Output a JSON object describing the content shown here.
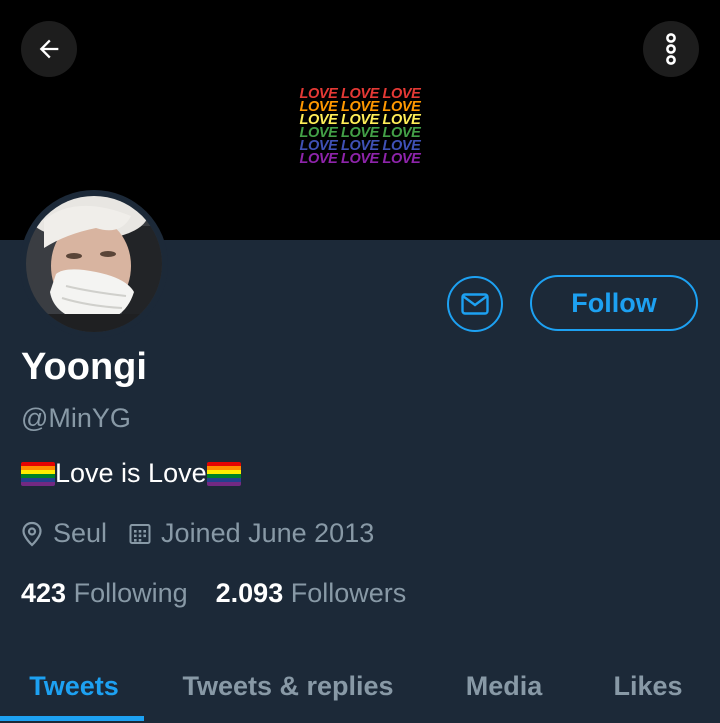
{
  "header": {
    "back_icon": "arrow-left-icon",
    "more_icon": "more-vertical-icon"
  },
  "banner": {
    "background": "#000000",
    "art_lines": [
      {
        "text": "LOVE LOVE LOVE",
        "color": "#e53935"
      },
      {
        "text": "LOVE LOVE LOVE",
        "color": "#ff9800"
      },
      {
        "text": "LOVE LOVE LOVE",
        "color": "#ffee58"
      },
      {
        "text": "LOVE LOVE LOVE",
        "color": "#43a047"
      },
      {
        "text": "LOVE LOVE LOVE",
        "color": "#3f51b5"
      },
      {
        "text": "LOVE LOVE LOVE",
        "color": "#8e24aa"
      }
    ]
  },
  "profile": {
    "name": "Yoongi",
    "handle": "@MinYG",
    "bio_text": "Love is Love",
    "location": "Seul",
    "joined": "Joined June 2013",
    "following_count": "423",
    "following_label": "Following",
    "followers_count": "2.093",
    "followers_label": "Followers"
  },
  "actions": {
    "message_icon": "envelope-icon",
    "follow_label": "Follow"
  },
  "tabs": [
    {
      "label": "Tweets",
      "active": true
    },
    {
      "label": "Tweets & replies",
      "active": false
    },
    {
      "label": "Media",
      "active": false
    },
    {
      "label": "Likes",
      "active": false
    }
  ],
  "colors": {
    "background": "#1c2938",
    "accent": "#1da1f2",
    "secondary_text": "#8899a6",
    "primary_text": "#ffffff"
  }
}
